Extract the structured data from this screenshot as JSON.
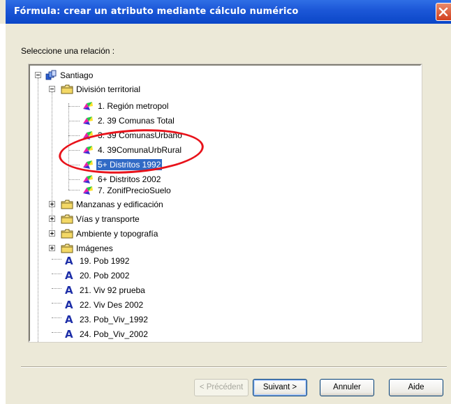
{
  "window": {
    "title": "Fórmula: crear un atributo mediante cálculo numérico"
  },
  "prompt": "Seleccione una relación :",
  "tree": {
    "root": {
      "label": "Santiago",
      "icon": "database-icon"
    },
    "folder_open": {
      "label": "División territorial",
      "icon": "folder-icon"
    },
    "children": [
      {
        "label": "1. Región metropol",
        "icon": "map-layer-icon"
      },
      {
        "label": "2. 39 Comunas Total",
        "icon": "map-layer-icon"
      },
      {
        "label": "3. 39 ComunasUrbano",
        "icon": "map-layer-icon"
      },
      {
        "label": "4. 39ComunaUrbRural",
        "icon": "map-layer-icon"
      },
      {
        "label": "5+ Distritos 1992",
        "icon": "map-layer-icon",
        "selected": true
      },
      {
        "label": "6+ Distritos 2002",
        "icon": "map-layer-icon"
      },
      {
        "label": "7. ZonifPrecioSuelo",
        "icon": "map-layer-icon"
      }
    ],
    "folders": [
      {
        "label": "Manzanas y edificación",
        "icon": "folder-icon"
      },
      {
        "label": "Vías y transporte",
        "icon": "folder-icon"
      },
      {
        "label": "Ambiente y topografía",
        "icon": "folder-icon"
      },
      {
        "label": "Imágenes",
        "icon": "folder-icon"
      }
    ],
    "attributes": [
      {
        "label": "19. Pob 1992",
        "icon": "attribute-a-icon"
      },
      {
        "label": "20. Pob 2002",
        "icon": "attribute-a-icon"
      },
      {
        "label": "21. Viv 92 prueba",
        "icon": "attribute-a-icon"
      },
      {
        "label": "22. Viv Des 2002",
        "icon": "attribute-a-icon"
      },
      {
        "label": "23. Pob_Viv_1992",
        "icon": "attribute-a-icon"
      },
      {
        "label": "24. Pob_Viv_2002",
        "icon": "attribute-a-icon"
      }
    ]
  },
  "buttons": {
    "previous": "< Précédent",
    "next": "Suivant >",
    "cancel": "Annuler",
    "help": "Aide"
  },
  "colors": {
    "selection": "#316ac5",
    "highlight_ellipse": "#e8121a",
    "titlebar": "#0a46c7"
  }
}
